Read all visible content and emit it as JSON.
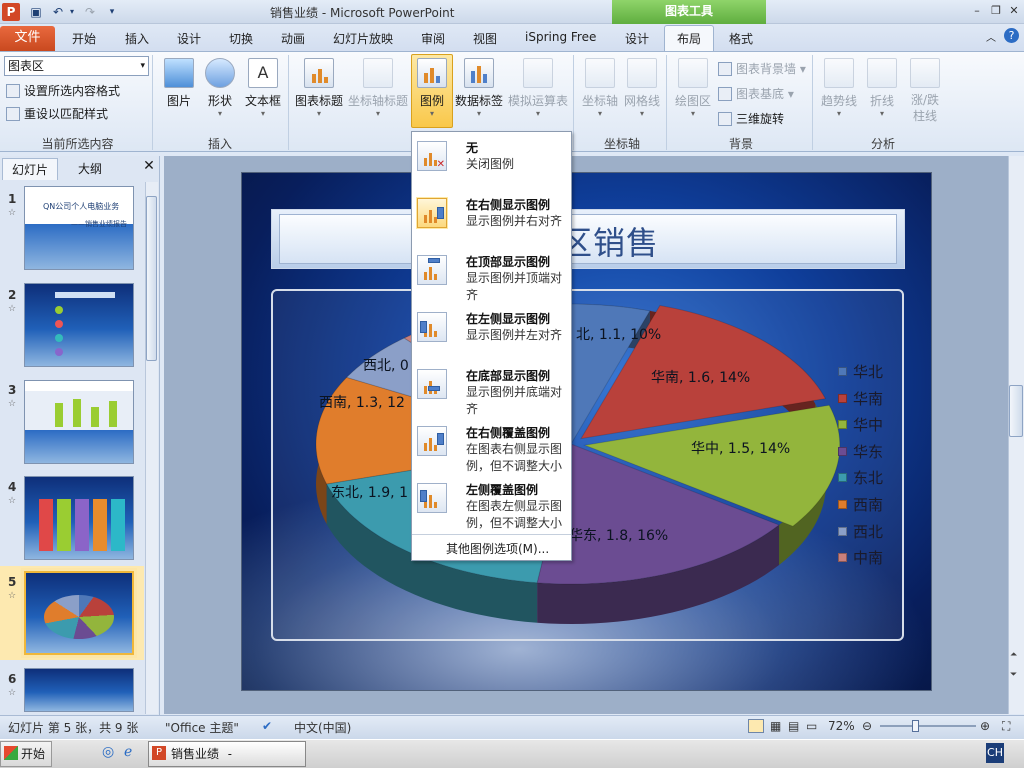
{
  "window": {
    "title": "销售业绩 - Microsoft PowerPoint",
    "app_icon": "P",
    "context_group": "图表工具"
  },
  "quick_access": {
    "save_icon": "save-icon",
    "undo_icon": "undo-icon",
    "redo_icon": "redo-icon"
  },
  "tabs": [
    "文件",
    "开始",
    "插入",
    "设计",
    "切换",
    "动画",
    "幻灯片放映",
    "审阅",
    "视图",
    "iSpring Free",
    "设计",
    "布局",
    "格式"
  ],
  "active_tab": "布局",
  "ribbon": {
    "current_selection": {
      "select_value": "图表区",
      "format_btn": "设置所选内容格式",
      "reset_btn": "重设以匹配样式",
      "group": "当前所选内容"
    },
    "insert": {
      "picture": "图片",
      "shapes": "形状",
      "textbox": "文本框",
      "group": "插入"
    },
    "labels": {
      "chart_title": "图表标题",
      "axis_titles": "坐标轴标题",
      "legend": "图例",
      "data_labels": "数据标签",
      "data_table": "模拟运算表"
    },
    "axes": {
      "axes": "坐标轴",
      "gridlines": "网格线",
      "group": "坐标轴"
    },
    "background": {
      "plot_area": "绘图区",
      "chart_wall": "图表背景墙",
      "chart_floor": "图表基底",
      "rotation": "三维旋转",
      "group": "背景"
    },
    "analysis": {
      "trendline": "趋势线",
      "lines": "折线",
      "updown": "涨/跌",
      "updown2": "柱线",
      "group": "分析"
    }
  },
  "legend_menu": {
    "items": [
      {
        "title": "无",
        "desc": "关闭图例"
      },
      {
        "title": "在右侧显示图例",
        "desc": "显示图例并右对齐"
      },
      {
        "title": "在顶部显示图例",
        "desc": "显示图例并顶端对齐"
      },
      {
        "title": "在左侧显示图例",
        "desc": "显示图例并左对齐"
      },
      {
        "title": "在底部显示图例",
        "desc": "显示图例并底端对齐"
      },
      {
        "title": "在右侧覆盖图例",
        "desc": "在图表右侧显示图例，但不调整大小"
      },
      {
        "title": "左侧覆盖图例",
        "desc": "在图表左侧显示图例，但不调整大小"
      }
    ],
    "more": "其他图例选项(M)...",
    "highlighted_index": 1
  },
  "slide_panel": {
    "tab_slides": "幻灯片",
    "tab_outline": "大纲",
    "thumbnails": [
      {
        "num": "1",
        "line1": "QN公司个人电脑业务",
        "line2": "——销售业绩报告"
      },
      {
        "num": "2"
      },
      {
        "num": "3"
      },
      {
        "num": "4"
      },
      {
        "num": "5"
      },
      {
        "num": "6"
      }
    ],
    "selected": "5"
  },
  "slide": {
    "title_visible": "区销售"
  },
  "chart_data": {
    "type": "pie",
    "title": "",
    "categories": [
      "华北",
      "华南",
      "华中",
      "华东",
      "东北",
      "西南",
      "西北",
      "中南"
    ],
    "values": [
      1.1,
      1.6,
      1.5,
      1.8,
      1.9,
      1.3,
      null,
      null
    ],
    "percents": [
      "10%",
      "14%",
      "14%",
      "16%",
      "",
      "12%",
      "",
      ""
    ],
    "visible_labels": [
      "北, 1.1, 10%",
      "华南, 1.6, 14%",
      "华中, 1.5, 14%",
      "华东, 1.8, 16%",
      "东北, 1.9, 1",
      "西南, 1.3, 12",
      "西北, 0"
    ],
    "colors": [
      "#4f78b8",
      "#b9413b",
      "#93b53c",
      "#6b4c92",
      "#3c9bae",
      "#e07d2c",
      "#8b9fc8",
      "#c9807c"
    ],
    "legend_position": "right"
  },
  "statusbar": {
    "slide_info": "幻灯片 第 5 张，共 9 张",
    "theme": "\"Office 主题\"",
    "lang": "中文(中国)",
    "zoom": "72%"
  },
  "taskbar": {
    "start": "开始",
    "app": "销售业绩 - Microsof...",
    "ime": "CH"
  }
}
